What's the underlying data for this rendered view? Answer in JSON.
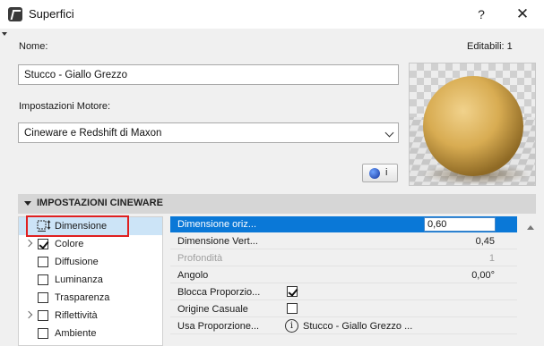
{
  "window": {
    "title": "Superfici",
    "help_label": "?",
    "close_label": "✕"
  },
  "form": {
    "name_label": "Nome:",
    "editable_label": "Editabili: 1",
    "name_value": "Stucco - Giallo Grezzo",
    "engine_label": "Impostazioni Motore:",
    "engine_value": "Cineware e Redshift di Maxon",
    "info_button_label": "i"
  },
  "section": {
    "title": "IMPOSTAZIONI CINEWARE"
  },
  "tree": {
    "items": [
      {
        "label": "Dimensione",
        "icon": "dimension-icon",
        "selected": true
      },
      {
        "label": "Colore",
        "checked": true,
        "expandable": true
      },
      {
        "label": "Diffusione",
        "checked": false
      },
      {
        "label": "Luminanza",
        "checked": false
      },
      {
        "label": "Trasparenza",
        "checked": false
      },
      {
        "label": "Riflettività",
        "checked": false,
        "expandable": true
      },
      {
        "label": "Ambiente",
        "checked": false
      }
    ]
  },
  "props": {
    "rows": [
      {
        "name": "Dimensione oriz...",
        "value": "0,60"
      },
      {
        "name": "Dimensione Vert...",
        "value": "0,45"
      },
      {
        "name": "Profondità",
        "value": "1"
      },
      {
        "name": "Angolo",
        "value": "0,00°"
      },
      {
        "name": "Blocca Proporzio...",
        "checked": true
      },
      {
        "name": "Origine Casuale",
        "checked": false
      },
      {
        "name": "Usa Proporzione...",
        "value": "Stucco - Giallo Grezzo ...",
        "info_icon": "i"
      }
    ]
  },
  "colors": {
    "accent": "#0a78d7",
    "selection": "#cce4f7",
    "highlight": "#e02020",
    "material": "#d4a84b"
  }
}
